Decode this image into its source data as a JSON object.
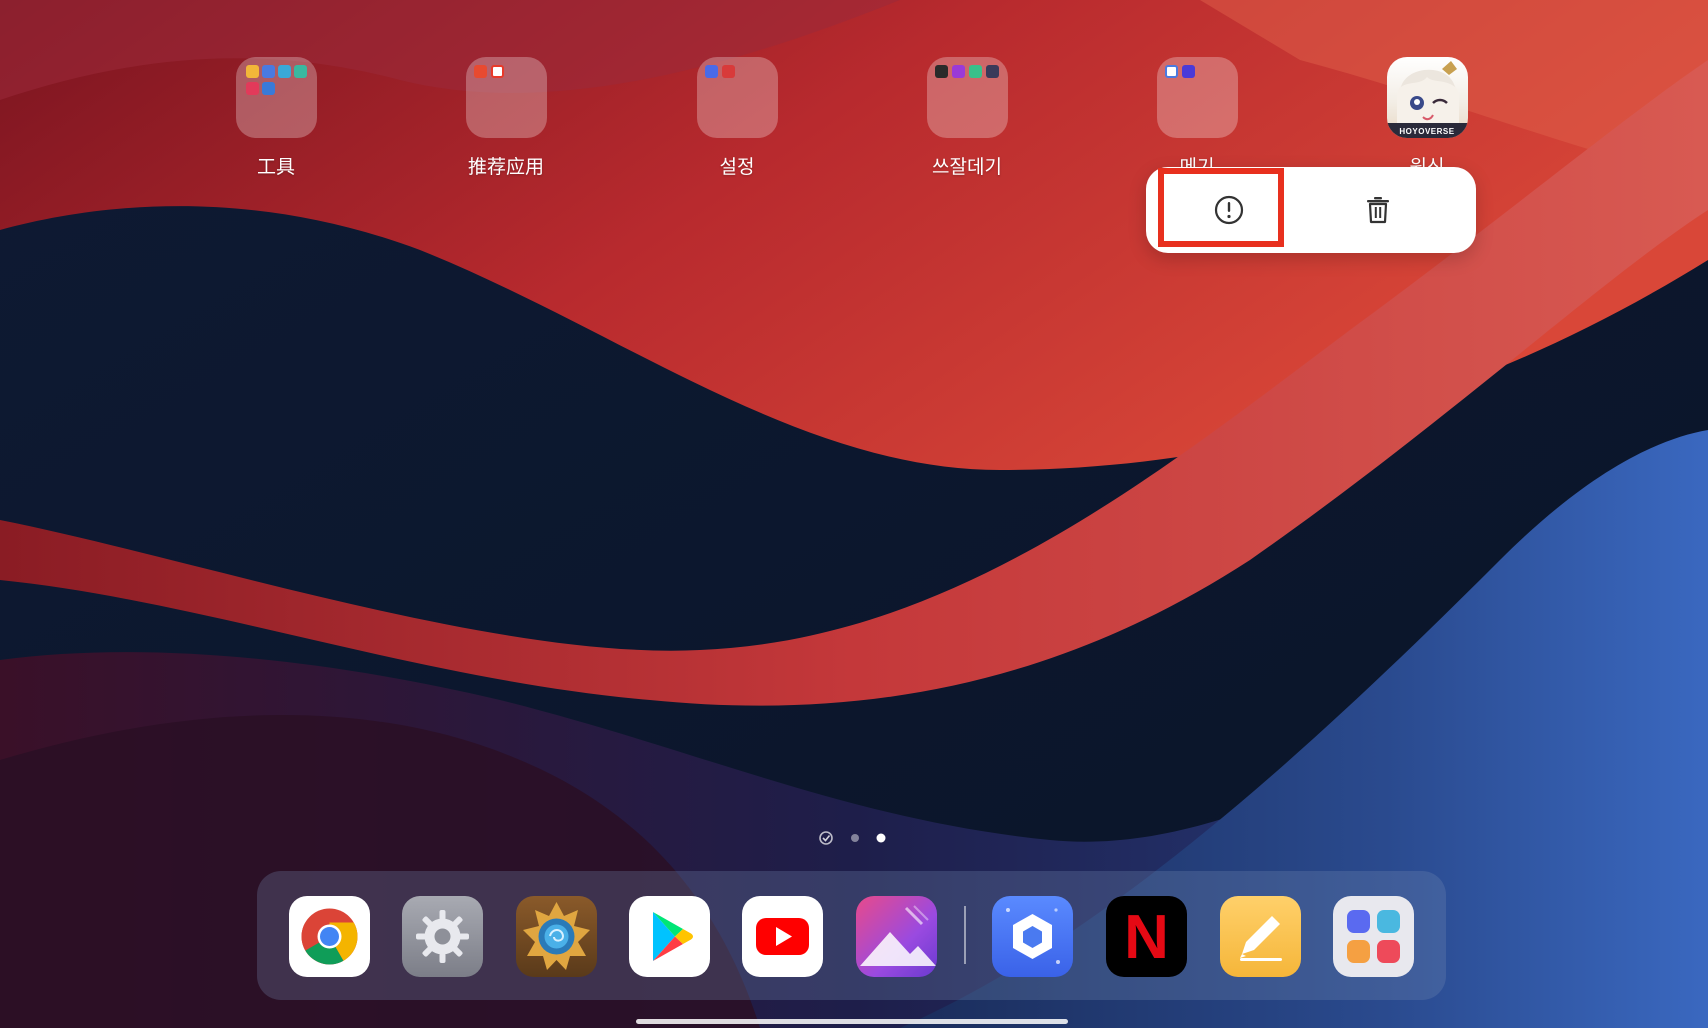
{
  "home_screen": {
    "apps": [
      {
        "label": "工具",
        "type": "folder"
      },
      {
        "label": "推荐应用",
        "type": "folder"
      },
      {
        "label": "설정",
        "type": "folder"
      },
      {
        "label": "쓰잘데기",
        "type": "folder"
      },
      {
        "label": "메기",
        "type": "folder"
      },
      {
        "label": "원신",
        "type": "app",
        "icon_text": "HOYOVERSE"
      }
    ]
  },
  "context_menu": {
    "info_icon": "info-icon",
    "delete_icon": "trash-icon"
  },
  "page_indicator": {
    "pages": 3,
    "current_page": 3
  },
  "dock": {
    "apps": [
      {
        "name": "chrome-icon"
      },
      {
        "name": "settings-gear-icon"
      },
      {
        "name": "hearthstone-icon"
      },
      {
        "name": "play-store-icon"
      },
      {
        "name": "youtube-icon"
      },
      {
        "name": "gallery-icon"
      },
      {
        "name": "cube-app-icon"
      },
      {
        "name": "netflix-icon",
        "icon_text": "N"
      },
      {
        "name": "notes-pencil-icon"
      },
      {
        "name": "app-drawer-icon"
      }
    ]
  },
  "colors": {
    "highlight": "#e8301e",
    "popup_bg": "#ffffff"
  }
}
